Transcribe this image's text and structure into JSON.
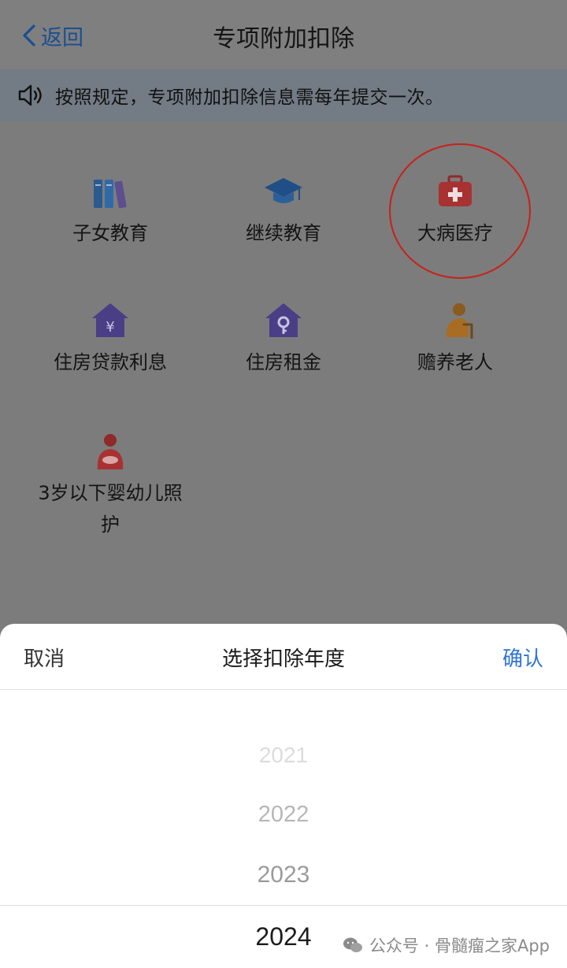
{
  "nav": {
    "back_label": "返回",
    "title": "专项附加扣除"
  },
  "notice": {
    "text": "按照规定，专项附加扣除信息需每年提交一次。"
  },
  "items": [
    {
      "label": "子女教育",
      "icon": "books-icon"
    },
    {
      "label": "继续教育",
      "icon": "graduation-cap-icon"
    },
    {
      "label": "大病医疗",
      "icon": "medical-kit-icon"
    },
    {
      "label": "住房贷款利息",
      "icon": "house-yuan-icon"
    },
    {
      "label": "住房租金",
      "icon": "house-key-icon"
    },
    {
      "label": "赡养老人",
      "icon": "elderly-person-icon"
    },
    {
      "label": "3岁以下婴幼儿照护",
      "icon": "mother-baby-icon"
    }
  ],
  "sheet": {
    "cancel_label": "取消",
    "title": "选择扣除年度",
    "confirm_label": "确认"
  },
  "years": [
    "2021",
    "2022",
    "2023",
    "2024"
  ],
  "watermark": {
    "text": "公众号 · 骨髓瘤之家App"
  },
  "colors": {
    "accent": "#2f74d4",
    "back_link": "#1a4f92",
    "highlight": "#c8201a"
  }
}
